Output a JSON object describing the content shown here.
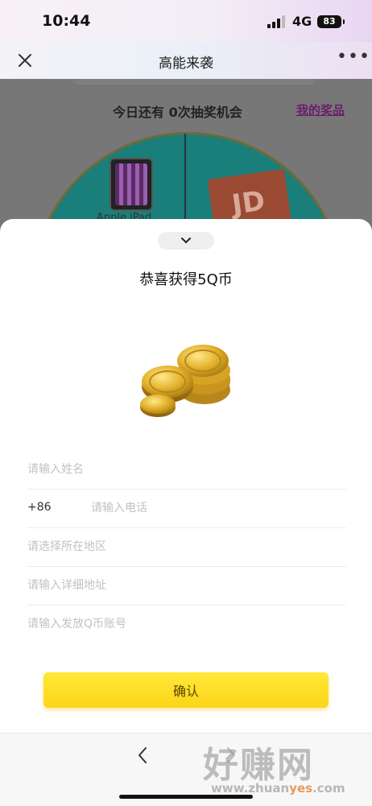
{
  "status_bar": {
    "time": "10:44",
    "network": "4G",
    "battery": "83"
  },
  "title_bar": {
    "title": "高能来袭",
    "close_icon": "close-icon",
    "more_icon": "more-icon",
    "more_text": "•••"
  },
  "background_page": {
    "chances_text": "今日还有 0次抽奖机会",
    "my_prizes": "我的奖品",
    "prize_ipad": "Apple iPad",
    "wheel_color": "#1a7e7a"
  },
  "sheet": {
    "collapse_icon": "chevron-down-icon",
    "title": "恭喜获得5Q币",
    "coins_icon": "q-coins-icon",
    "form": {
      "name_placeholder": "请输入姓名",
      "phone_prefix": "+86",
      "phone_placeholder": "请输入电话",
      "region_placeholder": "请选择所在地区",
      "address_placeholder": "请输入详细地址",
      "qq_placeholder": "请输入发放Q币账号"
    },
    "confirm_label": "确认",
    "accent_color": "#fcd516"
  },
  "bottom_bar": {
    "back_icon": "chevron-left-icon",
    "forward_icon": "chevron-right-icon"
  },
  "watermark": {
    "brand": "好赚网",
    "url_a": "www.zhuan",
    "url_b": "yes",
    "url_c": ".com"
  }
}
